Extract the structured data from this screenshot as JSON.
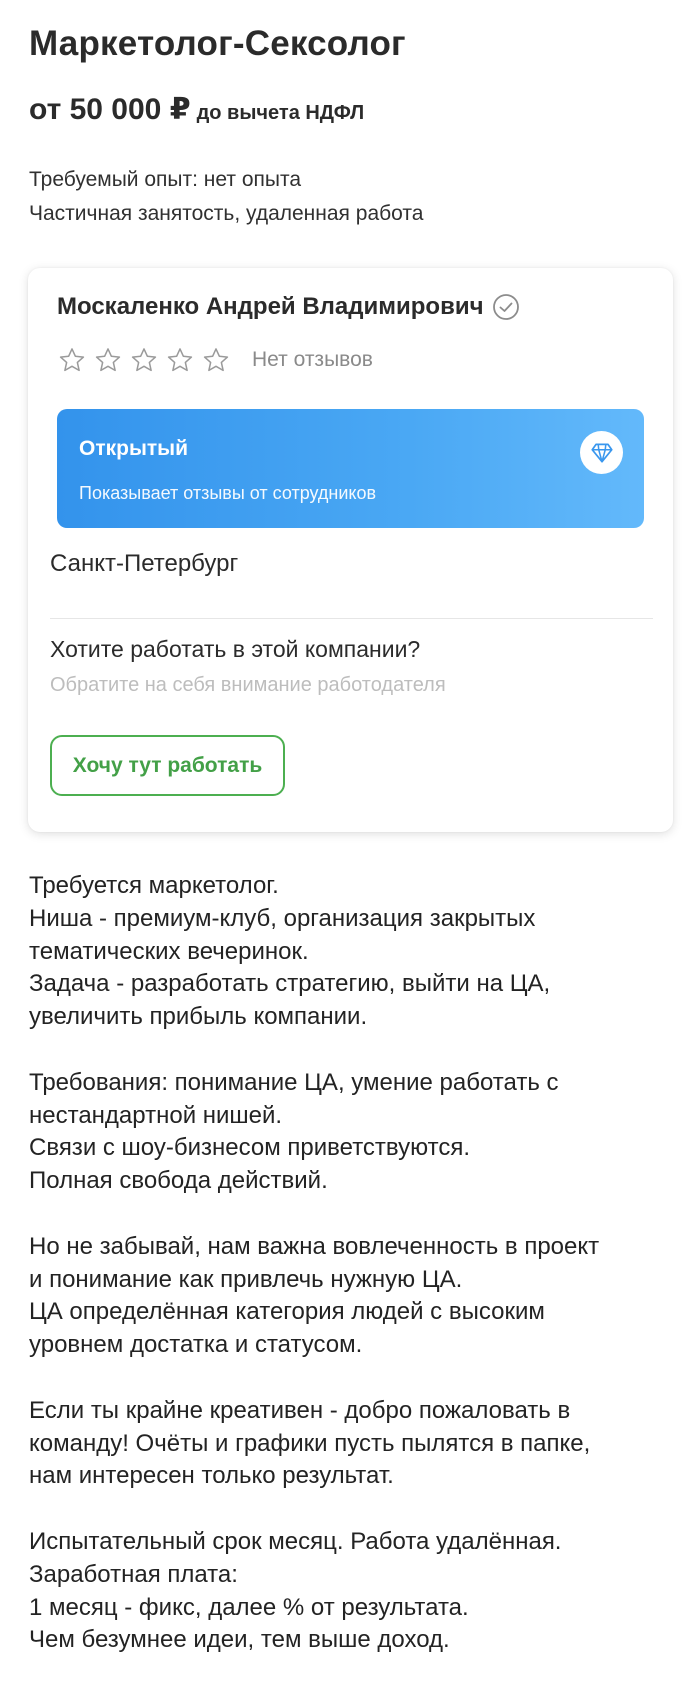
{
  "vacancy": {
    "title": "Маркетолог-Сексолог",
    "salary_amount": "от 50 000 ₽",
    "salary_suffix": "до вычета НДФЛ",
    "experience": "Требуемый опыт: нет опыта",
    "employment": "Частичная занятость, удаленная работа"
  },
  "company": {
    "name": "Москаленко Андрей Владимирович",
    "verified_icon": "check-circle-icon",
    "rating_stars": 0,
    "rating_max": 5,
    "reviews_text": "Нет отзывов",
    "open_badge": {
      "title": "Открытый",
      "description": "Показывает отзывы от сотрудников",
      "icon": "gem-icon"
    },
    "city": "Санкт-Петербург",
    "cta_title": "Хотите работать в этой компании?",
    "cta_subtitle": "Обратите на себя внимание работодателя",
    "cta_button": "Хочу тут работать"
  },
  "description_lines": [
    "Требуется маркетолог.",
    "Ниша - премиум-клуб, организация закрытых",
    "тематических вечеринок.",
    "Задача - разработать стратегию, выйти на ЦА,",
    "увеличить прибыль компании.",
    "",
    "Требования: понимание ЦА, умение работать с",
    "нестандартной нишей.",
    "Связи с шоу-бизнесом приветствуются.",
    "Полная свобода действий.",
    "",
    "Но не забывай, нам важна вовлеченность в проект",
    "и понимание как привлечь нужную ЦА.",
    "ЦА определённая категория людей с высоким",
    "уровнем достатка и статусом.",
    "",
    "Если ты крайне креативен - добро пожаловать в",
    "команду! Очёты и графики пусть пылятся в папке,",
    "нам интересен только результат.",
    "",
    "Испытательный срок месяц. Работа удалённая.",
    "Заработная плата:",
    "1 месяц - фикс, далее % от результата.",
    "Чем безумнее идеи, тем выше доход."
  ],
  "colors": {
    "accent_green": "#4caf50",
    "banner_blue": "#3393ec",
    "text_muted": "#8a8a8a"
  }
}
